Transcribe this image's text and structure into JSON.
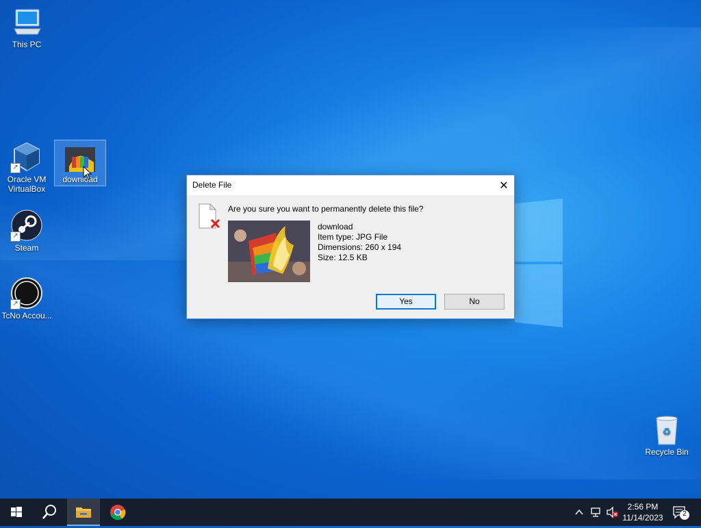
{
  "desktop": {
    "icons": [
      {
        "label": "This PC",
        "icon": "this-pc-icon"
      },
      {
        "label": "Oracle VM VirtualBox",
        "icon": "virtualbox-icon"
      },
      {
        "label": "download",
        "icon": "image-file-icon"
      },
      {
        "label": "Steam",
        "icon": "steam-icon"
      },
      {
        "label": "TcNo Accou...",
        "icon": "tcno-icon"
      },
      {
        "label": "Recycle Bin",
        "icon": "recycle-bin-icon"
      }
    ]
  },
  "dialog": {
    "title": "Delete File",
    "question": "Are you sure you want to permanently delete this file?",
    "file": {
      "name": "download",
      "type": "Item type: JPG File",
      "dimensions": "Dimensions: 260 x 194",
      "size": "Size: 12.5 KB"
    },
    "buttons": {
      "yes": "Yes",
      "no": "No"
    }
  },
  "taskbar": {
    "time": "2:56 PM",
    "date": "11/14/2023",
    "notifications_count": "2"
  },
  "colors": {
    "accent": "#0078d7",
    "taskbar": "#141e2c",
    "desktop": "#1a86e8"
  }
}
